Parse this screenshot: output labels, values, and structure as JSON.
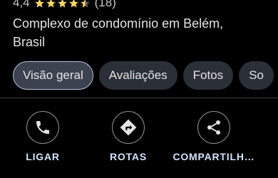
{
  "place": {
    "rating_value": "4,4",
    "rating_stars": 4.4,
    "review_count": "(18)",
    "type_line": "Complexo de condomínio em Belém,",
    "location_line": "Brasil"
  },
  "tabs": [
    {
      "label": "Visão geral",
      "active": true
    },
    {
      "label": "Avaliações",
      "active": false
    },
    {
      "label": "Fotos",
      "active": false
    },
    {
      "label": "So",
      "active": false
    }
  ],
  "actions": [
    {
      "label": "LIGAR",
      "icon": "phone-icon"
    },
    {
      "label": "ROTAS",
      "icon": "directions-icon"
    },
    {
      "label": "COMPARTILH…",
      "icon": "share-icon"
    }
  ],
  "colors": {
    "background": "#000000",
    "star": "#fdd663",
    "action_label": "#d3e3fd",
    "tab_active_border": "#b9c3d8"
  }
}
